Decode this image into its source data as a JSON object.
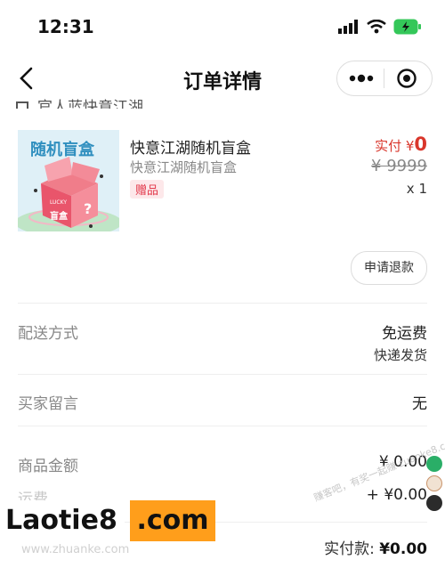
{
  "status_bar": {
    "time": "12:31"
  },
  "nav": {
    "title": "订单详情"
  },
  "store": {
    "name": "官人蓝快意江湖"
  },
  "product": {
    "image_texts": {
      "heading": "随机盲盒",
      "box_small": "LUCKY",
      "box_big": "盲盒"
    },
    "name": "快意江湖随机盲盒",
    "spec": "快意江湖随机盲盒",
    "tag": "赠品",
    "paid_label": "实付 ¥",
    "paid_value": "0",
    "original_price": "¥ 9999",
    "quantity": "x 1"
  },
  "refund_button": "申请退款",
  "rows": {
    "delivery": {
      "label": "配送方式",
      "value": "免运费",
      "sub": "快递发货"
    },
    "message": {
      "label": "买家留言",
      "value": "无"
    },
    "amount": {
      "label": "商品金额",
      "value": "¥ 0.00"
    },
    "freight": {
      "label": "运费",
      "value": "+ ¥0.00"
    },
    "total": {
      "label": "实付款:",
      "value": "¥0.00"
    }
  },
  "watermark": {
    "logo_left": "Laotie8",
    "logo_right": ".com",
    "site": "www.zhuanke.com",
    "diagonal": "赚客吧，有奖一起赚 zuanke8.com"
  },
  "colors": {
    "accent_red": "#d9362b",
    "gift_red": "#e2384a",
    "watermark_orange": "#ff9e1b"
  }
}
